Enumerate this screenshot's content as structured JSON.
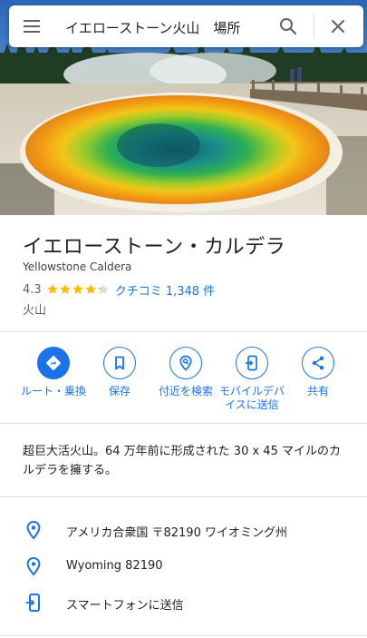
{
  "search": {
    "query": "イエローストーン火山　場所",
    "menu_icon": "menu-icon",
    "search_icon": "search-icon",
    "close_icon": "close-icon"
  },
  "place": {
    "name": "イエローストーン・カルデラ",
    "subtitle": "Yellowstone Caldera",
    "rating": "4.3",
    "rating_value": 4.3,
    "stars_max": 5,
    "reviews": "クチコミ 1,348 件",
    "category": "火山"
  },
  "actions": [
    {
      "label": "ルート・乗換",
      "icon": "directions-icon"
    },
    {
      "label": "保存",
      "icon": "bookmark-icon"
    },
    {
      "label": "付近を検索",
      "icon": "nearby-search-icon"
    },
    {
      "label": "モバイルデバイスに送信",
      "icon": "send-to-device-icon"
    },
    {
      "label": "共有",
      "icon": "share-icon"
    }
  ],
  "description": "超巨大活火山。64 万年前に形成された 30 x 45 マイルのカルデラを擁する。",
  "info": [
    {
      "text": "アメリカ合衆国 〒82190 ワイオミング州",
      "icon": "location-pin-icon"
    },
    {
      "text": "Wyoming 82190",
      "icon": "location-pin-icon"
    },
    {
      "text": "スマートフォンに送信",
      "icon": "send-to-phone-icon"
    }
  ],
  "colors": {
    "accent": "#1a73e8",
    "star": "#fbbc04",
    "text": "#202124",
    "secondary_text": "#5f6368",
    "divider": "#e0e0e0"
  }
}
